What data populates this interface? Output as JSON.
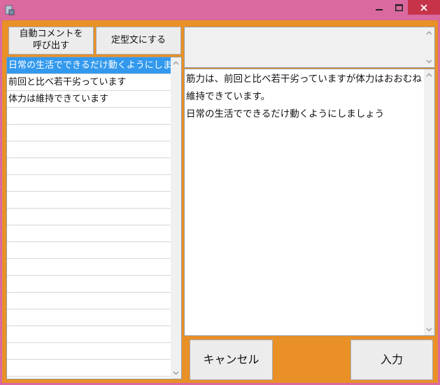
{
  "window": {
    "icons": {
      "app": "app-icon",
      "minimize": "minimize-icon",
      "maximize": "maximize-icon",
      "close": "close-icon"
    }
  },
  "buttons": {
    "auto_comment": "自動コメントを\n呼び出す",
    "fixed_phrase": "定型文にする",
    "cancel": "キャンセル",
    "enter": "入力"
  },
  "list": {
    "items": [
      "日常の生活でできるだけ動くようにしましょう",
      "前回と比べ若干劣っています",
      "体力は維持できています",
      "",
      "",
      "",
      "",
      "",
      "",
      "",
      "",
      "",
      "",
      "",
      "",
      "",
      "",
      "",
      "",
      ""
    ],
    "selected_index": 0
  },
  "editor": {
    "lines": [
      "筋力は、前回と比べ若干劣っていますが体力はおおむね",
      "維持できています。",
      "日常の生活でできるだけ動くようにしましょう"
    ]
  },
  "colors": {
    "titlebar": "#d9699e",
    "client": "#e99027",
    "close": "#c7344a",
    "selection": "#3399ee"
  }
}
